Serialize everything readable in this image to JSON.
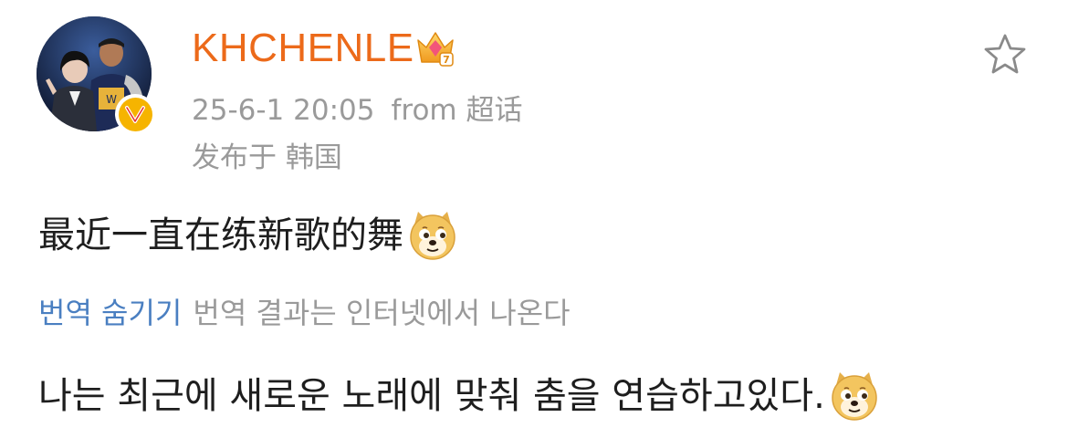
{
  "post": {
    "author": {
      "name": "KHCHENLE",
      "avatar_icon": "user-avatar-photo",
      "verified_badge_letter": "v",
      "badge_icon": "crown-icon"
    },
    "meta": {
      "time": "25-6-1 20:05",
      "source": "from 超话",
      "location": "发布于 韩国"
    },
    "text": "最近一直在练新歌的舞",
    "translation": {
      "hide_label": "번역 숨기기",
      "note": "번역 결과는 인터넷에서 나온다",
      "text": "나는 최근에 새로운 노래에 맞춰 춤을 연습하고있다."
    },
    "emoji_icon": "doge-emoji-icon",
    "actions": {
      "favorite_icon": "star-outline-icon"
    }
  },
  "colors": {
    "username": "#ec6a1a",
    "meta": "#9a9a9a",
    "link": "#4a7fc1",
    "badge": "#f6b400",
    "text": "#1e1e1e"
  }
}
